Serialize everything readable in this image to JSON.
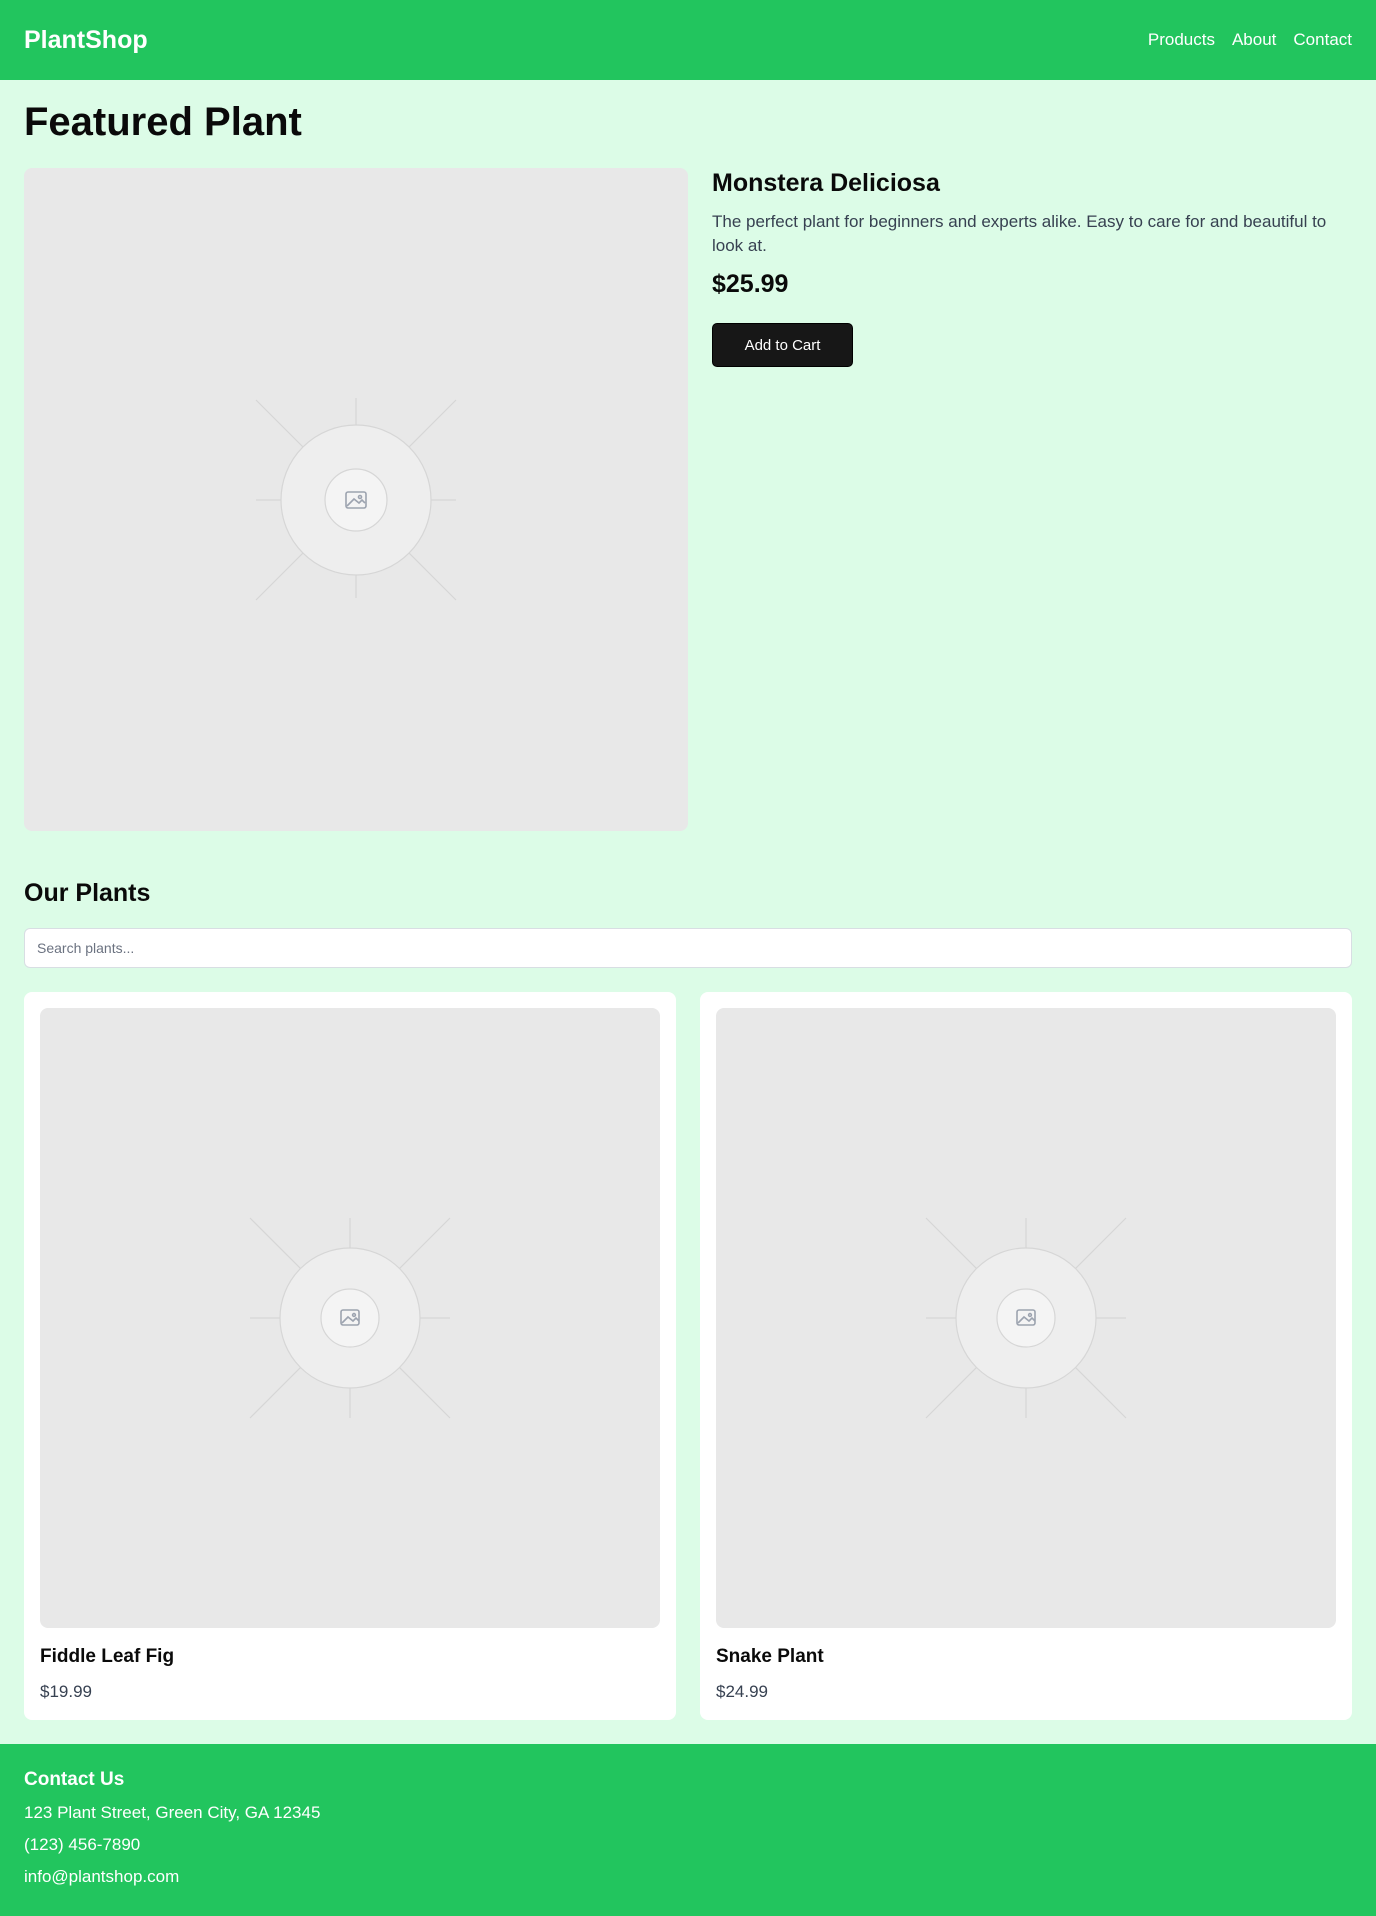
{
  "header": {
    "brand": "PlantShop",
    "nav": [
      "Products",
      "About",
      "Contact"
    ]
  },
  "featured": {
    "heading": "Featured Plant",
    "name": "Monstera Deliciosa",
    "description": "The perfect plant for beginners and experts alike. Easy to care for and beautiful to look at.",
    "price": "$25.99",
    "button_label": "Add to Cart",
    "image_icon": "image-placeholder-icon"
  },
  "plants": {
    "heading": "Our Plants",
    "search_placeholder": "Search plants...",
    "items": [
      {
        "name": "Fiddle Leaf Fig",
        "price": "$19.99"
      },
      {
        "name": "Snake Plant",
        "price": "$24.99"
      }
    ]
  },
  "footer": {
    "heading": "Contact Us",
    "address": "123 Plant Street, Green City, GA 12345",
    "phone": "(123) 456-7890",
    "email": "info@plantshop.com"
  },
  "colors": {
    "brand_green": "#22c55e",
    "page_background": "#dcfce7",
    "button_dark": "#171717"
  }
}
